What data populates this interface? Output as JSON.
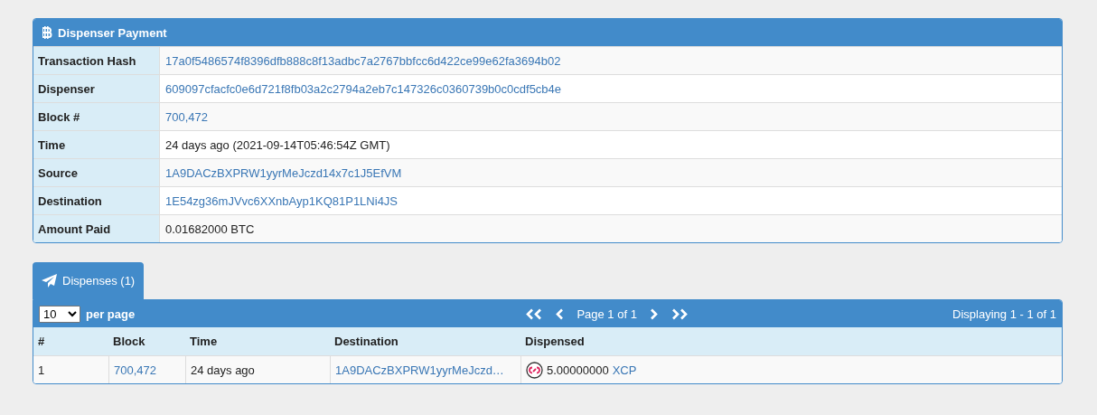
{
  "payment": {
    "title": "Dispenser Payment",
    "rows": [
      {
        "label": "Transaction Hash",
        "value": "17a0f5486574f8396dfb888c8f13adbc7a2767bbfcc6d422ce99e62fa3694b02",
        "kind": "link"
      },
      {
        "label": "Dispenser",
        "value": "609097cfacfc0e6d721f8fb03a2c2794a2eb7c147326c0360739b0c0cdf5cb4e",
        "kind": "link"
      },
      {
        "label": "Block #",
        "value": "700,472",
        "kind": "link"
      },
      {
        "label": "Time",
        "value": "24 days ago (2021-09-14T05:46:54Z GMT)",
        "kind": "text"
      },
      {
        "label": "Source",
        "value": "1A9DACzBXPRW1yyrMeJczd14x7c1J5EfVM",
        "kind": "link"
      },
      {
        "label": "Destination",
        "value": "1E54zg36mJVvc6XXnbAyp1KQ81P1LNi4JS",
        "kind": "link"
      },
      {
        "label": "Amount Paid",
        "value": "0.01682000 BTC",
        "kind": "text"
      }
    ]
  },
  "tabs": [
    {
      "label": "Dispenses (1)",
      "selected": true
    }
  ],
  "toolbar": {
    "per_page": "10",
    "per_page_label": "per page",
    "page_label": "Page 1 of 1",
    "displaying": "Displaying 1 - 1 of 1"
  },
  "table": {
    "columns": [
      "#",
      "Block",
      "Time",
      "Destination",
      "Dispensed"
    ],
    "rows": [
      {
        "index": "1",
        "block": "700,472",
        "time": "24 days ago",
        "destination": "1A9DACzBXPRW1yyrMeJczd…",
        "amount": "5.00000000",
        "asset": "XCP"
      }
    ]
  }
}
